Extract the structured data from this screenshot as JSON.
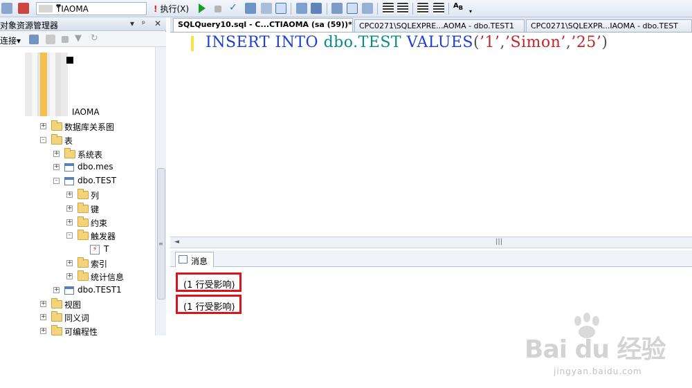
{
  "toolbar": {
    "database": "TIAOMA",
    "execute_label": "执行(X)",
    "icons": [
      "new-query-icon",
      "database-icon",
      "execute-icon",
      "debug-icon",
      "stop-icon",
      "parse-icon",
      "display-plan-icon",
      "results-to-text-icon",
      "results-to-grid-icon",
      "comment-icon",
      "uncomment-icon",
      "indent-icon",
      "outdent-icon",
      "specify-values-icon"
    ]
  },
  "explorer": {
    "title": "对象资源管理器",
    "title_controls": [
      "▾",
      "ᵖ",
      "✕"
    ],
    "connect_label": "连接▾",
    "server_partial": "IAOMA",
    "tree": [
      {
        "label": "数据库关系图",
        "icon": "folder",
        "state": "+"
      },
      {
        "label": "表",
        "icon": "folder",
        "state": "-"
      },
      {
        "label": "系统表",
        "icon": "folder",
        "state": "+"
      },
      {
        "label": "dbo.mes",
        "icon": "table",
        "state": "+"
      },
      {
        "label": "dbo.TEST",
        "icon": "table",
        "state": "-"
      },
      {
        "label": "列",
        "icon": "folder",
        "state": "+"
      },
      {
        "label": "键",
        "icon": "folder",
        "state": "+"
      },
      {
        "label": "约束",
        "icon": "folder",
        "state": "+"
      },
      {
        "label": "触发器",
        "icon": "folder",
        "state": "-"
      },
      {
        "label": "T",
        "icon": "trigger",
        "state": ""
      },
      {
        "label": "索引",
        "icon": "folder",
        "state": "+"
      },
      {
        "label": "统计信息",
        "icon": "folder",
        "state": "+"
      },
      {
        "label": "dbo.TEST1",
        "icon": "table",
        "state": "+"
      },
      {
        "label": "视图",
        "icon": "folder",
        "state": "+"
      },
      {
        "label": "同义词",
        "icon": "folder",
        "state": "+"
      },
      {
        "label": "可编程性",
        "icon": "folder",
        "state": "+"
      }
    ]
  },
  "tabs": [
    {
      "label": "SQLQuery10.sql - C...CTIAOMA (sa (59))*",
      "active": true
    },
    {
      "label": "CPC0271\\SQLEXPRE...AOMA - dbo.TEST1",
      "active": false
    },
    {
      "label": "CPC0271\\SQLEXPR...IAOMA - dbo.TEST",
      "active": false
    }
  ],
  "editor": {
    "kw_insert": "INSERT",
    "kw_into": "INTO",
    "object": "dbo.TEST",
    "kw_values": "VALUES",
    "open": "(",
    "v1": "’1’",
    "comma1": ",",
    "v2": "’Simon’",
    "comma2": ",",
    "v3": "’25’",
    "close": ")"
  },
  "results": {
    "tab_label": "消息",
    "messages": [
      "(1 行受影响)",
      "(1 行受影响)"
    ]
  },
  "watermark": {
    "logo": "Bai du 经验",
    "url": "jingyan.baidu.com"
  }
}
